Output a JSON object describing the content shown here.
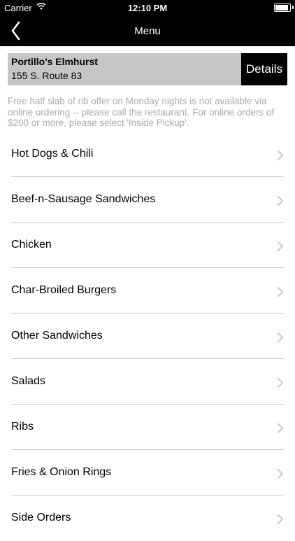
{
  "status_bar": {
    "carrier": "Carrier",
    "time": "12:10 PM",
    "battery_level": 1.0,
    "wifi_icon": "wifi-icon",
    "battery_icon": "battery-icon"
  },
  "nav": {
    "title": "Menu",
    "back_icon": "chevron-left-icon"
  },
  "restaurant": {
    "name": "Portillo's Elmhurst",
    "address": "155 S. Route 83",
    "details_label": "Details"
  },
  "notice": "Free half slab of rib offer on Monday nights is not available via online ordering -- please call the restaurant. For online orders of $200 or more, please select 'Inside Pickup'.",
  "menu": {
    "items": [
      {
        "label": "Hot Dogs & Chili"
      },
      {
        "label": "Beef-n-Sausage Sandwiches"
      },
      {
        "label": "Chicken"
      },
      {
        "label": "Char-Broiled Burgers"
      },
      {
        "label": "Other Sandwiches"
      },
      {
        "label": "Salads"
      },
      {
        "label": "Ribs"
      },
      {
        "label": "Fries & Onion Rings"
      },
      {
        "label": "Side Orders"
      }
    ],
    "chevron_icon": "chevron-right-icon"
  },
  "colors": {
    "bar": "#000000",
    "restaurant_bg": "#c6c6c6",
    "notice_text": "#aaaaaa",
    "divider": "#c8c8c8",
    "chevron": "#c7c7cc"
  }
}
